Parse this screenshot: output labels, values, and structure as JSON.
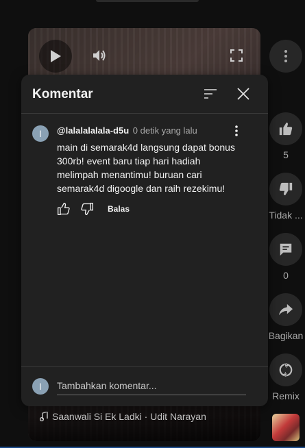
{
  "video": {
    "music_title": "Saanwali Si Ek Ladki · Udit Narayan"
  },
  "rail": {
    "like_count": "5",
    "dislike_label": "Tidak ...",
    "comment_count": "0",
    "share_label": "Bagikan",
    "remix_label": "Remix"
  },
  "comments_panel": {
    "title": "Komentar",
    "comment": {
      "avatar_initial": "l",
      "author": "@lalalalalala-d5u",
      "time": "0 detik yang lalu",
      "text": "main di semarak4d langsung dapat bonus 300rb! event baru tiap hari hadiah melimpah menantimu! buruan cari semarak4d digoogle dan raih rezekimu!",
      "reply_label": "Balas"
    },
    "footer": {
      "avatar_initial": "l",
      "placeholder": "Tambahkan komentar..."
    }
  },
  "colors": {
    "panel_bg": "#212121",
    "avatar_bg": "#8aa1b4",
    "rail_btn_bg": "#272727"
  }
}
